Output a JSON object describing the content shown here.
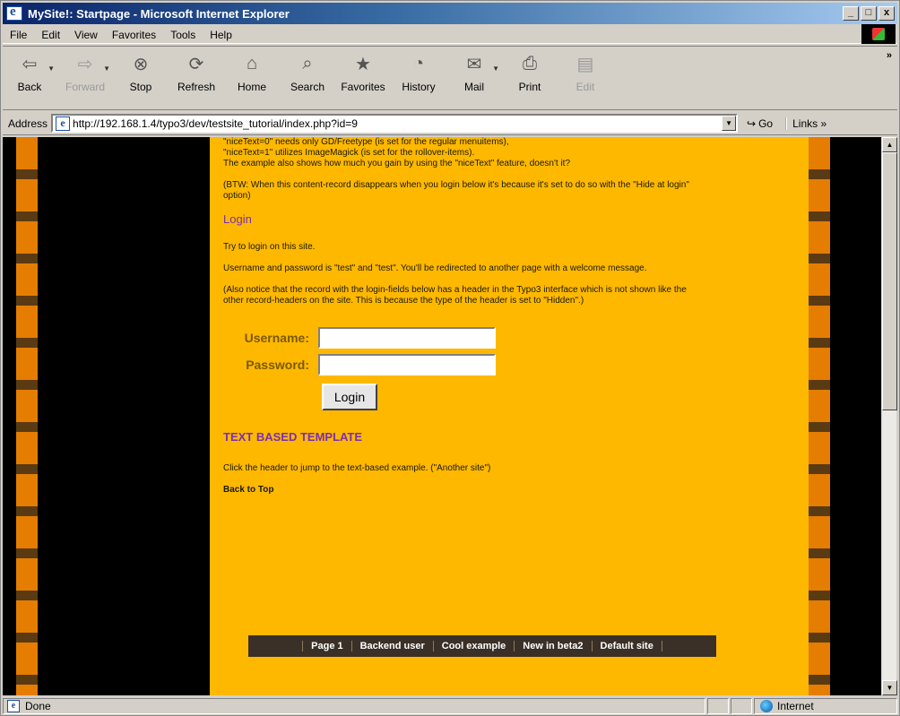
{
  "window": {
    "title": "MySite!: Startpage - Microsoft Internet Explorer",
    "controls": [
      "_",
      "□",
      "x"
    ]
  },
  "menubar": {
    "items": [
      "File",
      "Edit",
      "View",
      "Favorites",
      "Tools",
      "Help"
    ]
  },
  "toolbar": {
    "buttons": [
      {
        "label": "Back",
        "icon": "back-arrow-icon",
        "glyph": "⇦"
      },
      {
        "label": "Forward",
        "icon": "forward-arrow-icon",
        "glyph": "⇨"
      },
      {
        "label": "Stop",
        "icon": "stop-icon",
        "glyph": "⊗"
      },
      {
        "label": "Refresh",
        "icon": "refresh-icon",
        "glyph": "⟳"
      },
      {
        "label": "Home",
        "icon": "home-icon",
        "glyph": "⌂"
      },
      {
        "label": "Search",
        "icon": "search-icon",
        "glyph": "⌕"
      },
      {
        "label": "Favorites",
        "icon": "favorites-icon",
        "glyph": "★"
      },
      {
        "label": "History",
        "icon": "history-icon",
        "glyph": "◔"
      },
      {
        "label": "Mail",
        "icon": "mail-icon",
        "glyph": "✉"
      },
      {
        "label": "Print",
        "icon": "print-icon",
        "glyph": "⎙"
      },
      {
        "label": "Edit",
        "icon": "edit-icon",
        "glyph": "▤"
      }
    ],
    "more": "»"
  },
  "addressbar": {
    "label": "Address",
    "url": "http://192.168.1.4/typo3/dev/testsite_tutorial/index.php?id=9",
    "go_label": "Go",
    "links_label": "Links »"
  },
  "content": {
    "intro_lines": [
      "\"niceText=0\" needs only GD/Freetype (is set for the regular menuitems),",
      "\"niceText=1\" utilizes ImageMagick (is set for the rollover-items).",
      "The example also shows how much you gain by using the \"niceText\" feature, doesn't it?"
    ],
    "btw_note": "(BTW: When this content-record disappears when you login below it's because it's set to do so with the \"Hide at login\" option)",
    "login_heading": "Login",
    "login_intro": "Try to login on this site.",
    "login_credentials": "Username and password is \"test\" and \"test\". You'll be redirected to another page with a welcome message.",
    "login_note": "(Also notice that the record with the login-fields below has a header in the Typo3 interface which is not shown like the other record-headers on the site. This is because the type of the header is set to \"Hidden\".)",
    "username_label": "Username:",
    "password_label": "Password:",
    "username_value": "",
    "password_value": "",
    "login_button": "Login",
    "text_template_heading": "TEXT BASED TEMPLATE",
    "text_template_desc": "Click the header to jump to the text-based example. (\"Another site\")",
    "back_to_top": "Back to Top",
    "footer_nav": [
      "Page 1",
      "Backend user",
      "Cool example",
      "New in beta2",
      "Default site"
    ]
  },
  "statusbar": {
    "status": "Done",
    "zone": "Internet"
  },
  "colors": {
    "content_bg": "#ffb800",
    "heading": "#7a2fae",
    "stripe_orange": "#e57d00",
    "stripe_dark": "#5a3a12",
    "footer_bg": "#3a3027"
  }
}
